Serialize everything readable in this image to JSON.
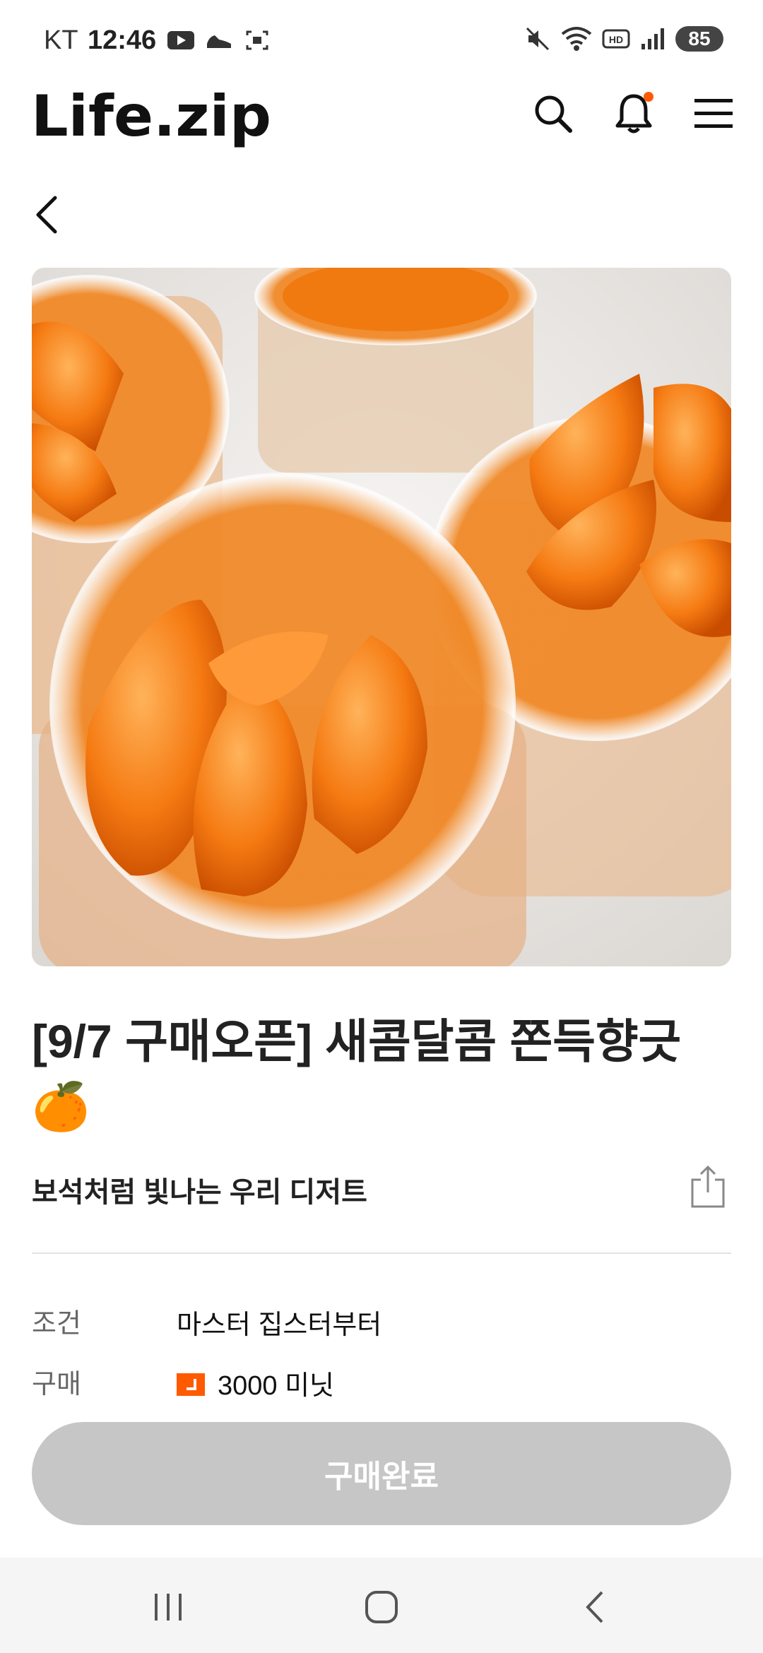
{
  "status_bar": {
    "carrier": "KT",
    "time": "12:46",
    "battery": "85"
  },
  "header": {
    "logo_text": "Life.zip",
    "notification_dot_color": "#ff5a00"
  },
  "product": {
    "title": "[9/7 구매오픈] 새콤달콤 쫀득향긋 🍊",
    "subtitle": "보석처럼 빛나는 우리 디저트",
    "condition_label": "조건",
    "condition_value": "마스터 집스터부터",
    "price_label": "구매",
    "price_value": "3000 미닛",
    "buy_button": "구매완료"
  },
  "colors": {
    "accent": "#ff5a00",
    "button_disabled": "#c6c6c6"
  }
}
